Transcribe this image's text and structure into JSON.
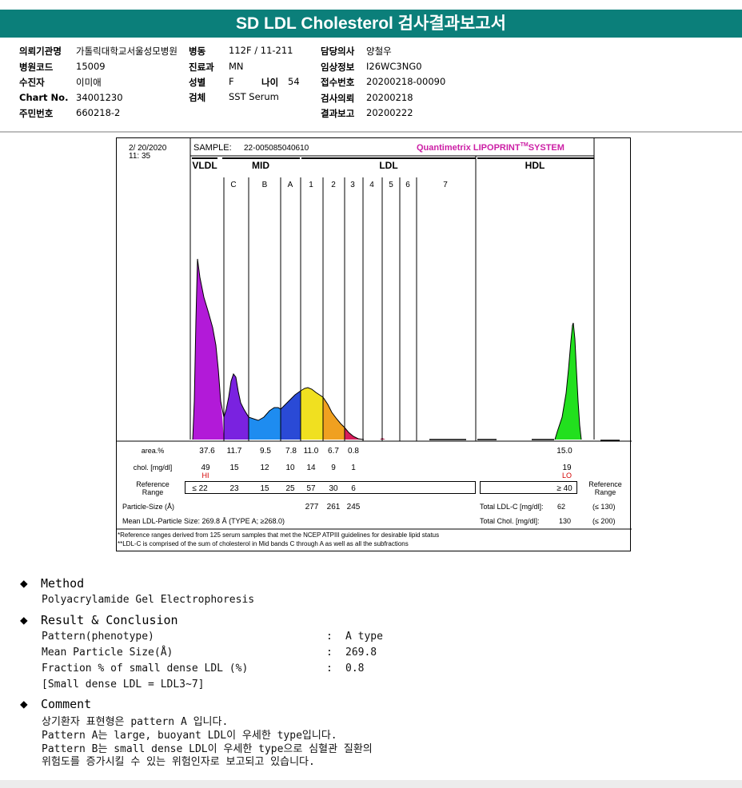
{
  "title": "SD LDL Cholesterol 검사결과보고서",
  "info": {
    "hospital_label": "의뢰기관명",
    "hospital_value": "가톨릭대학교서울성모병원",
    "ward_label": "병동",
    "ward_value": "112F / 11-211",
    "doctor_label": "담당의사",
    "doctor_value": "양철우",
    "code_label": "병원코드",
    "code_value": "15009",
    "dept_label": "진료과",
    "dept_value": "MN",
    "clinical_label": "임상정보",
    "clinical_value": "I26WC3NG0",
    "patient_label": "수진자",
    "patient_value": "이미애",
    "sex_label": "성별",
    "sex_value": "F",
    "age_label": "나이",
    "age_value": "54",
    "receipt_label": "접수번호",
    "receipt_value": "20200218-00090",
    "chart_label": "Chart No.",
    "chart_value": "34001230",
    "specimen_label": "검체",
    "specimen_value": "SST Serum",
    "request_label": "검사의뢰",
    "request_value": "20200218",
    "id_label": "주민번호",
    "id_value": "660218-2",
    "reported_label": "결과보고",
    "reported_value": "20200222"
  },
  "report": {
    "date": "2/ 20/2020",
    "time": "11: 35",
    "sample_label": "SAMPLE:",
    "sample_value": "22-005085040610",
    "brand": "Quantimetrix LIPOPRINT",
    "brand_tm": "TM",
    "brand_system": "SYSTEM",
    "groups": [
      "VLDL",
      "MID",
      "LDL",
      "HDL"
    ],
    "bands": [
      "C",
      "B",
      "A",
      "1",
      "2",
      "3",
      "4",
      "5",
      "6",
      "7"
    ],
    "area_label": "area.%",
    "chol_label": "chol. [mg/dl]",
    "ref_label_1": "Reference",
    "ref_label_2": "Range",
    "area_values": [
      "37.6",
      "11.7",
      "9.5",
      "7.8",
      "11.0",
      "6.7",
      "0.8",
      "15.0"
    ],
    "chol_values": [
      "49",
      "15",
      "12",
      "10",
      "14",
      "9",
      "1",
      "19"
    ],
    "flag_hi": "HI",
    "flag_lo": "LO",
    "ref_values": [
      "≤ 22",
      "23",
      "15",
      "25",
      "57",
      "30",
      "6"
    ],
    "hdl_ref": "≥ 40",
    "particle_size_label": "Particle-Size (Å)",
    "particle_sizes": [
      "277",
      "261",
      "245"
    ],
    "total_ldl_label": "Total LDL-C [mg/dl]:",
    "total_ldl_value": "62",
    "total_ldl_range": "(≤ 130)",
    "mean_ldl_text": "Mean LDL-Particle Size:   269.8 Å   (TYPE A; ≥268.0)",
    "total_chol_label": "Total Chol. [mg/dl]:",
    "total_chol_value": "130",
    "total_chol_range": "(≤ 200)",
    "footnote_1": "*Reference ranges derived from 125 serum samples that met the NCEP ATPIII guidelines for desirable lipid status",
    "footnote_2": "**LDL-C is comprised of the sum of cholesterol in Mid bands C through A as well as all the subfractions",
    "colors": {
      "vldl": "#b21ad8",
      "midc": "#7a22e0",
      "midb": "#1e8cf0",
      "mida": "#2a4ad6",
      "ldl1": "#f0e020",
      "ldl2": "#f0a020",
      "ldl3": "#d81c5a",
      "hdl": "#22e01e"
    }
  },
  "sections": {
    "method_title": "Method",
    "method_text": "Polyacrylamide Gel Electrophoresis",
    "result_title": "Result & Conclusion",
    "rows": [
      {
        "label": "Pattern(phenotype)",
        "sep": ":",
        "value": "A type"
      },
      {
        "label": "Mean Particle Size(Å)",
        "sep": ":",
        "value": "269.8"
      },
      {
        "label": "Fraction % of small dense LDL (%)",
        "sep": ":",
        "value": "0.8"
      }
    ],
    "note": "[Small dense LDL = LDL3~7]",
    "comment_title": "Comment",
    "comment_lines": [
      "상기환자 표현형은 pattern A 입니다.",
      "Pattern A는 large, buoyant LDL이 우세한 type입니다.",
      "Pattern B는 small dense LDL이 우세한 type으로 심혈관 질환의",
      "위험도를 증가시킬 수 있는 위험인자로 보고되고 있습니다."
    ]
  }
}
